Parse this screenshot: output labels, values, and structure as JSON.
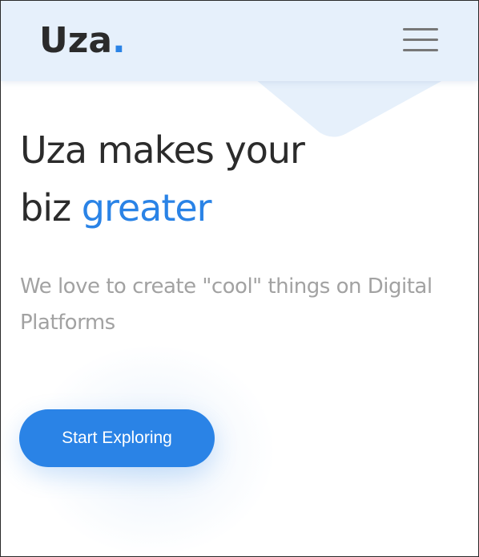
{
  "brand": {
    "name": "Uza",
    "dot": ".",
    "accent_color": "#2a83e6",
    "header_bg": "#e6f0fb"
  },
  "nav": {
    "menu_icon": "hamburger-menu-icon"
  },
  "hero": {
    "headline_line1": "Uza makes your",
    "headline_line2_prefix": "biz",
    "headline_line2_accent": "greater",
    "subtitle": "We love to create \"cool\" things on Digital Platforms",
    "cta_label": "Start Exploring"
  }
}
